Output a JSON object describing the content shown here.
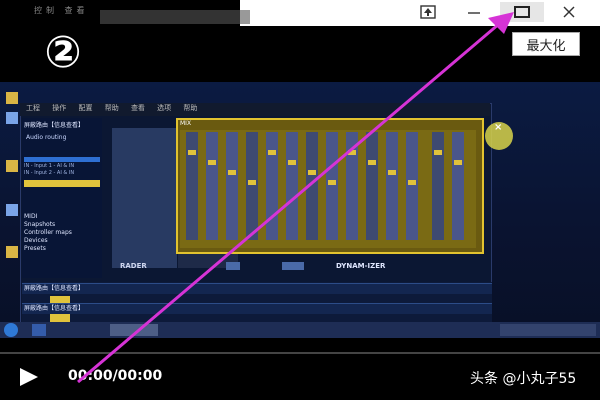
{
  "window": {
    "tooltip": "最大化",
    "step_number": "②",
    "top_menu": [
      "控制",
      "查看"
    ]
  },
  "app": {
    "menu": [
      "工程",
      "操作",
      "配置",
      "帮助",
      "查看",
      "选项",
      "帮助"
    ],
    "left_header": "屏蔽路由【信息查看】",
    "audio_routing": "Audio routing",
    "inputs": [
      "IN - Input 1 - AI & IN",
      "IN - Input 2 - AI & IN"
    ],
    "section_labels": [
      "MIDI",
      "Snapshots",
      "Controller maps",
      "Devices",
      "Presets"
    ],
    "mixer_title": "MIX",
    "mixer_sub": "DYNAM-IZER",
    "rack_titles": [
      "屏蔽路由【信息查看】",
      "屏蔽路由【信息查看】",
      "屏蔽路由【信息查看】"
    ]
  },
  "player": {
    "time": "00:00/00:00",
    "brand": "头条 @小丸子55"
  },
  "colors": {
    "accent_arrow": "#d633d6",
    "mixer_border": "#e2c32f",
    "mixer_bg": "#6a5a10"
  },
  "icons": [
    "pin-icon",
    "minimize-icon",
    "maximize-icon",
    "close-icon",
    "play-icon"
  ]
}
